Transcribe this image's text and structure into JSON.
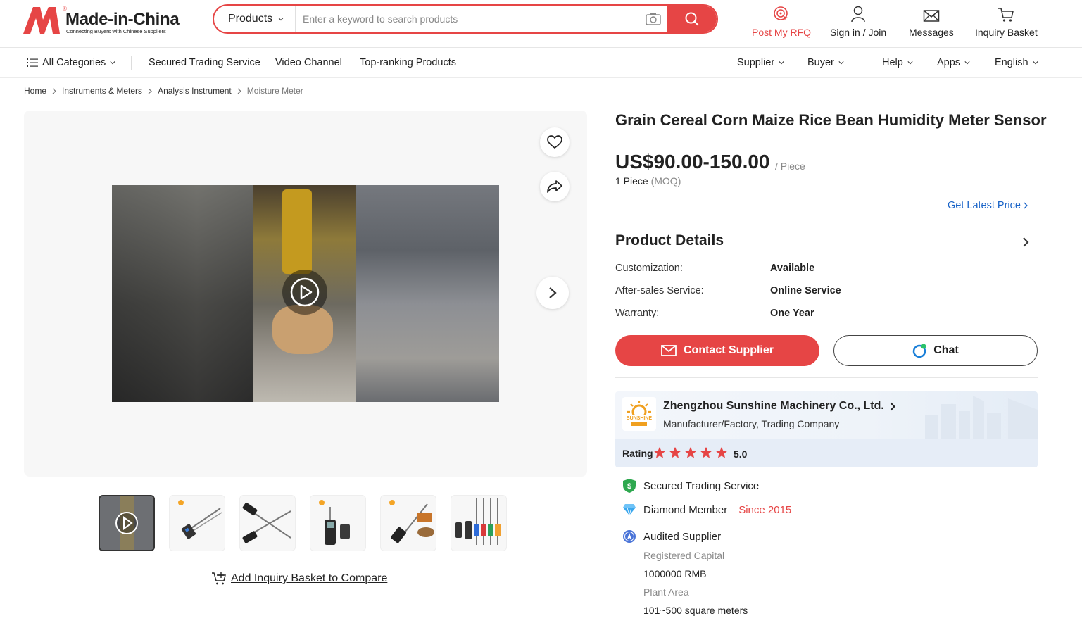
{
  "header": {
    "logo_text": "Made-in-China",
    "logo_tagline": "Connecting Buyers with Chinese Suppliers",
    "logo_reg": "®",
    "search_category": "Products",
    "search_placeholder": "Enter a keyword to search products",
    "links": {
      "rfq": "Post My RFQ",
      "signin": "Sign in / Join",
      "messages": "Messages",
      "basket": "Inquiry Basket"
    }
  },
  "nav": {
    "all_categories": "All Categories",
    "items": [
      "Secured Trading Service",
      "Video Channel",
      "Top-ranking Products"
    ],
    "right": [
      "Supplier",
      "Buyer",
      "Help",
      "Apps",
      "English"
    ]
  },
  "breadcrumb": [
    "Home",
    "Instruments & Meters",
    "Analysis Instrument",
    "Moisture Meter"
  ],
  "gallery": {
    "compare_label": "Add Inquiry Basket to Compare",
    "thumb_count": 6
  },
  "product": {
    "title": "Grain Cereal Corn Maize Rice Bean Humidity Meter Sensor",
    "price": "US$90.00-150.00",
    "price_unit": "/ Piece",
    "moq_qty": "1 Piece",
    "moq_label": "(MOQ)",
    "latest_price": "Get Latest Price",
    "details_title": "Product Details",
    "attributes": [
      {
        "key": "Customization:",
        "value": "Available"
      },
      {
        "key": "After-sales Service:",
        "value": "Online Service"
      },
      {
        "key": "Warranty:",
        "value": "One Year"
      }
    ],
    "contact_button": "Contact Supplier",
    "chat_button": "Chat"
  },
  "supplier": {
    "name": "Zhengzhou Sunshine Machinery Co., Ltd.",
    "type": "Manufacturer/Factory, Trading Company",
    "logo_text": "SUNSHINE",
    "rating_label": "Rating",
    "rating_value": "5.0",
    "rating_stars": 5,
    "badges": {
      "secured": "Secured Trading Service",
      "diamond": "Diamond Member",
      "since": "Since 2015",
      "audited": "Audited Supplier"
    },
    "info": [
      {
        "key": "Registered Capital",
        "value": "1000000 RMB"
      },
      {
        "key": "Plant Area",
        "value": "101~500 square meters"
      }
    ]
  },
  "colors": {
    "brand_red": "#e64545",
    "link_blue": "#1a64c8",
    "star_red": "#e64545"
  }
}
